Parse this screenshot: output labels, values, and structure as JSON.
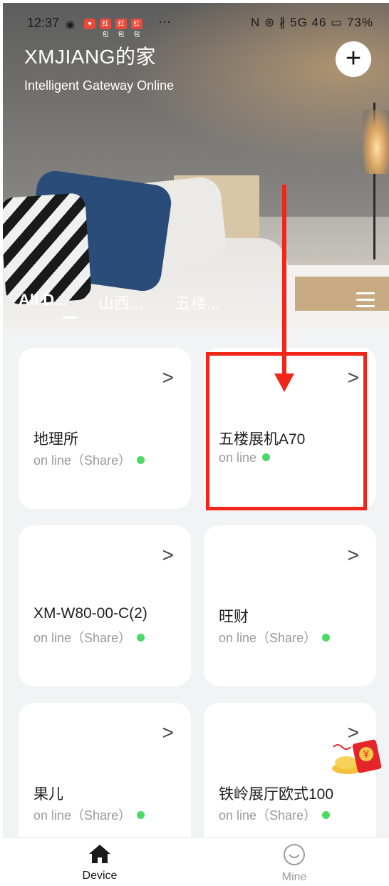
{
  "status_bar": {
    "time": "12:37",
    "eye_icon": "eye-icon",
    "notifications": [
      "红包",
      "红包",
      "红包",
      "红包"
    ],
    "more": "···",
    "right": "N ⊛ ∦ 5G 46 ▭ 73%"
  },
  "header": {
    "title": "XMJIANG的家",
    "subtitle": "Intelligent Gateway Online",
    "add_button": "+"
  },
  "tabs": [
    "All D...",
    "山西...",
    "五楼..."
  ],
  "devices": [
    {
      "name": "地理所",
      "status": "on line（Share）"
    },
    {
      "name": "五楼展机A70",
      "status": "on line"
    },
    {
      "name": "XM-W80-00-C(2)",
      "status": "on line（Share）"
    },
    {
      "name": "旺财",
      "status": "on line（Share）"
    },
    {
      "name": "果儿",
      "status": "on line（Share）"
    },
    {
      "name": "铁岭展厅欧式100",
      "status": "on line（Share）"
    }
  ],
  "chevron": ">",
  "nav": {
    "device": "Device",
    "mine": "Mine",
    "active_color": "#1a1a1a",
    "inactive_color": "#9a9a9a"
  },
  "colors": {
    "online_dot": "#4cd964",
    "annotation_red": "#f0261a"
  }
}
